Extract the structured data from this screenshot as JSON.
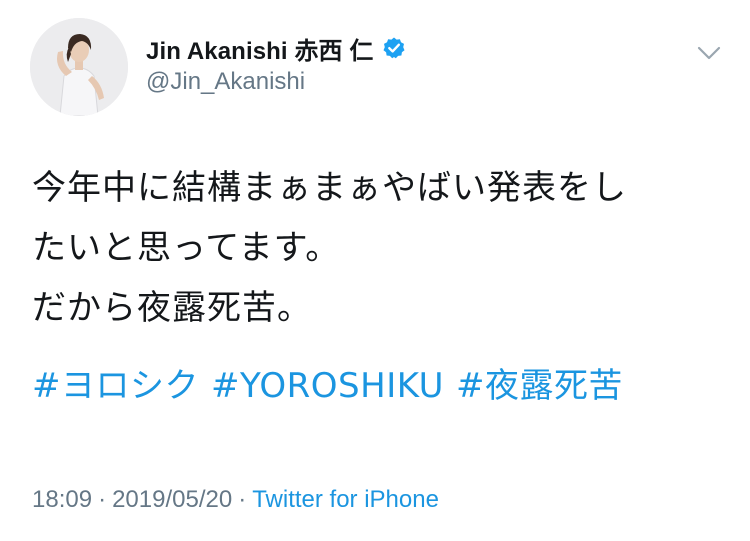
{
  "author": {
    "display_name": "Jin Akanishi  赤西 仁",
    "handle": "@Jin_Akanishi",
    "verified": true
  },
  "tweet": {
    "lines": [
      "今年中に結構まぁまぁやばい発表をし",
      "たいと思ってます。",
      "だから夜露死苦。"
    ],
    "hashtags": [
      "#ヨロシク",
      "#YOROSHIKU",
      "#夜露死苦"
    ]
  },
  "meta": {
    "time": "18:09",
    "separator": "·",
    "date": "2019/05/20",
    "source": "Twitter for iPhone"
  },
  "colors": {
    "link": "#1b95e0",
    "secondary_text": "#657786",
    "primary_text": "#14171a",
    "verified_badge": "#1da1f2"
  },
  "icons": {
    "verified": "verified-badge-icon",
    "menu": "chevron-down-icon"
  }
}
